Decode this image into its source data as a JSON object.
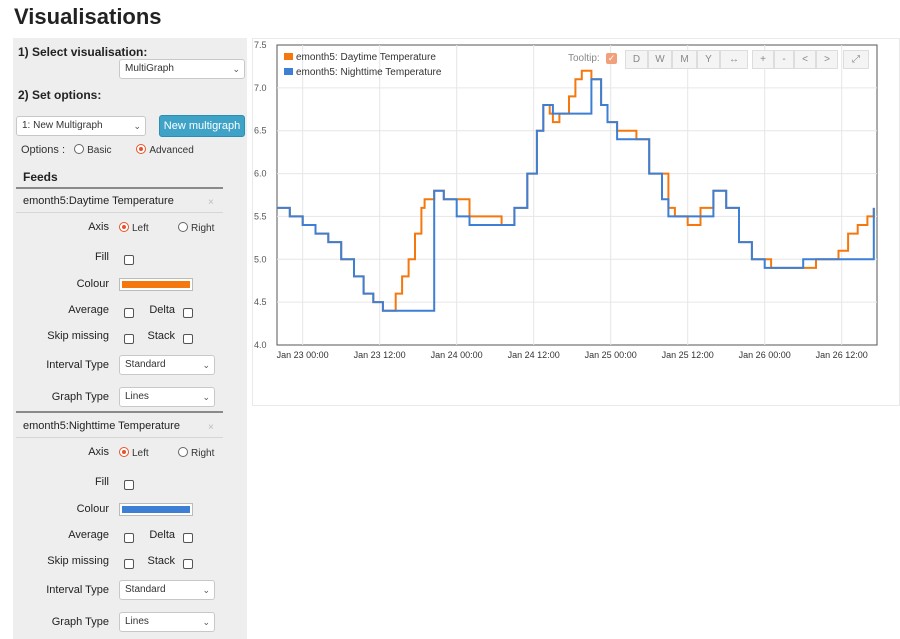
{
  "page": {
    "title": "Visualisations"
  },
  "panel": {
    "step1_label": "1) Select visualisation:",
    "visualisation_select": "MultiGraph",
    "step2_label": "2) Set options:",
    "multigraph_select": "1: New Multigraph",
    "new_multigraph_button": "New multigraph",
    "options_label": "Options :",
    "options": [
      "Basic",
      "Advanced"
    ],
    "options_selected": "Advanced",
    "feeds_title": "Feeds"
  },
  "feeds": [
    {
      "name": "emonth5:Daytime Temperature",
      "close": "×",
      "axis_label": "Axis",
      "axis_left": "Left",
      "axis_right": "Right",
      "axis_selected": "Left",
      "fill_label": "Fill",
      "colour_label": "Colour",
      "colour": "#f5780f",
      "average_label": "Average",
      "delta_label": "Delta",
      "skip_label": "Skip missing",
      "stack_label": "Stack",
      "interval_label": "Interval Type",
      "interval_value": "Standard",
      "graphtype_label": "Graph Type",
      "graphtype_value": "Lines"
    },
    {
      "name": "emonth5:Nighttime Temperature",
      "close": "×",
      "axis_label": "Axis",
      "axis_left": "Left",
      "axis_right": "Right",
      "axis_selected": "Left",
      "fill_label": "Fill",
      "colour_label": "Colour",
      "colour": "#3d7fd4",
      "average_label": "Average",
      "delta_label": "Delta",
      "skip_label": "Skip missing",
      "stack_label": "Stack",
      "interval_label": "Interval Type",
      "interval_value": "Standard",
      "graphtype_label": "Graph Type",
      "graphtype_value": "Lines"
    }
  ],
  "toolbar": {
    "tooltip_label": "Tooltip:",
    "buttons": [
      "D",
      "W",
      "M",
      "Y",
      "↔",
      "+",
      "-",
      "<",
      ">",
      "⤢"
    ]
  },
  "chart_data": {
    "type": "line",
    "ylim": [
      4.0,
      7.5
    ],
    "yticks": [
      "4.0",
      "4.5",
      "5.0",
      "5.5",
      "6.0",
      "6.5",
      "7.0",
      "7.5"
    ],
    "xticks": [
      "Jan 23 00:00",
      "Jan 23 12:00",
      "Jan 24 00:00",
      "Jan 24 12:00",
      "Jan 25 00:00",
      "Jan 25 12:00",
      "Jan 26 00:00",
      "Jan 26 12:00"
    ],
    "x_unit": "hours since Jan 23 00:00",
    "grid": true,
    "legend_position": "top-left",
    "series": [
      {
        "name": "emonth5: Daytime Temperature",
        "color": "#f5780f",
        "points": [
          [
            -4,
            5.6
          ],
          [
            -2,
            5.5
          ],
          [
            0,
            5.4
          ],
          [
            2,
            5.3
          ],
          [
            4,
            5.2
          ],
          [
            6,
            5.0
          ],
          [
            8,
            4.8
          ],
          [
            9.5,
            4.6
          ],
          [
            11,
            4.5
          ],
          [
            12.5,
            4.4
          ],
          [
            13.5,
            4.4
          ],
          [
            14.5,
            4.6
          ],
          [
            15.5,
            4.8
          ],
          [
            16.5,
            5.0
          ],
          [
            17.5,
            5.3
          ],
          [
            18.5,
            5.6
          ],
          [
            19,
            5.7
          ],
          [
            20.5,
            5.8
          ],
          [
            22,
            5.7
          ],
          [
            26,
            5.5
          ],
          [
            31,
            5.4
          ],
          [
            33,
            5.6
          ],
          [
            35,
            6.0
          ],
          [
            36.5,
            6.5
          ],
          [
            37.5,
            6.8
          ],
          [
            38.5,
            6.7
          ],
          [
            39,
            6.6
          ],
          [
            40,
            6.7
          ],
          [
            41.5,
            6.9
          ],
          [
            42.5,
            7.1
          ],
          [
            43.5,
            7.2
          ],
          [
            45,
            7.1
          ],
          [
            46.5,
            6.8
          ],
          [
            47.5,
            6.6
          ],
          [
            49,
            6.5
          ],
          [
            52,
            6.4
          ],
          [
            54,
            6.0
          ],
          [
            57,
            5.6
          ],
          [
            58,
            5.5
          ],
          [
            60,
            5.4
          ],
          [
            62,
            5.6
          ],
          [
            64,
            5.8
          ],
          [
            66,
            5.6
          ],
          [
            68,
            5.2
          ],
          [
            70,
            5.0
          ],
          [
            73,
            4.9
          ],
          [
            76,
            4.9
          ],
          [
            80,
            5.0
          ],
          [
            82,
            5.0
          ],
          [
            83.5,
            5.1
          ],
          [
            85,
            5.3
          ],
          [
            86.5,
            5.4
          ],
          [
            88,
            5.5
          ],
          [
            89,
            5.6
          ]
        ]
      },
      {
        "name": "emonth5: Nighttime Temperature",
        "color": "#3d7fd4",
        "points": [
          [
            -4,
            5.6
          ],
          [
            -2,
            5.5
          ],
          [
            0,
            5.4
          ],
          [
            2,
            5.3
          ],
          [
            4,
            5.2
          ],
          [
            6,
            5.0
          ],
          [
            8,
            4.8
          ],
          [
            9.5,
            4.6
          ],
          [
            11,
            4.5
          ],
          [
            12.5,
            4.4
          ],
          [
            13.5,
            4.4
          ],
          [
            20.5,
            5.8
          ],
          [
            22,
            5.7
          ],
          [
            24,
            5.5
          ],
          [
            26,
            5.4
          ],
          [
            31,
            5.4
          ],
          [
            33,
            5.6
          ],
          [
            35,
            6.0
          ],
          [
            36.5,
            6.5
          ],
          [
            37.5,
            6.8
          ],
          [
            38.5,
            6.8
          ],
          [
            39,
            6.7
          ],
          [
            45,
            7.1
          ],
          [
            46.5,
            6.8
          ],
          [
            47.5,
            6.6
          ],
          [
            49,
            6.4
          ],
          [
            52,
            6.4
          ],
          [
            54,
            6.0
          ],
          [
            56,
            5.7
          ],
          [
            57,
            5.5
          ],
          [
            64,
            5.8
          ],
          [
            66,
            5.6
          ],
          [
            68,
            5.2
          ],
          [
            70,
            5.0
          ],
          [
            72,
            4.9
          ],
          [
            76,
            4.9
          ],
          [
            78,
            5.0
          ],
          [
            82,
            5.0
          ],
          [
            89,
            5.6
          ]
        ]
      }
    ]
  }
}
